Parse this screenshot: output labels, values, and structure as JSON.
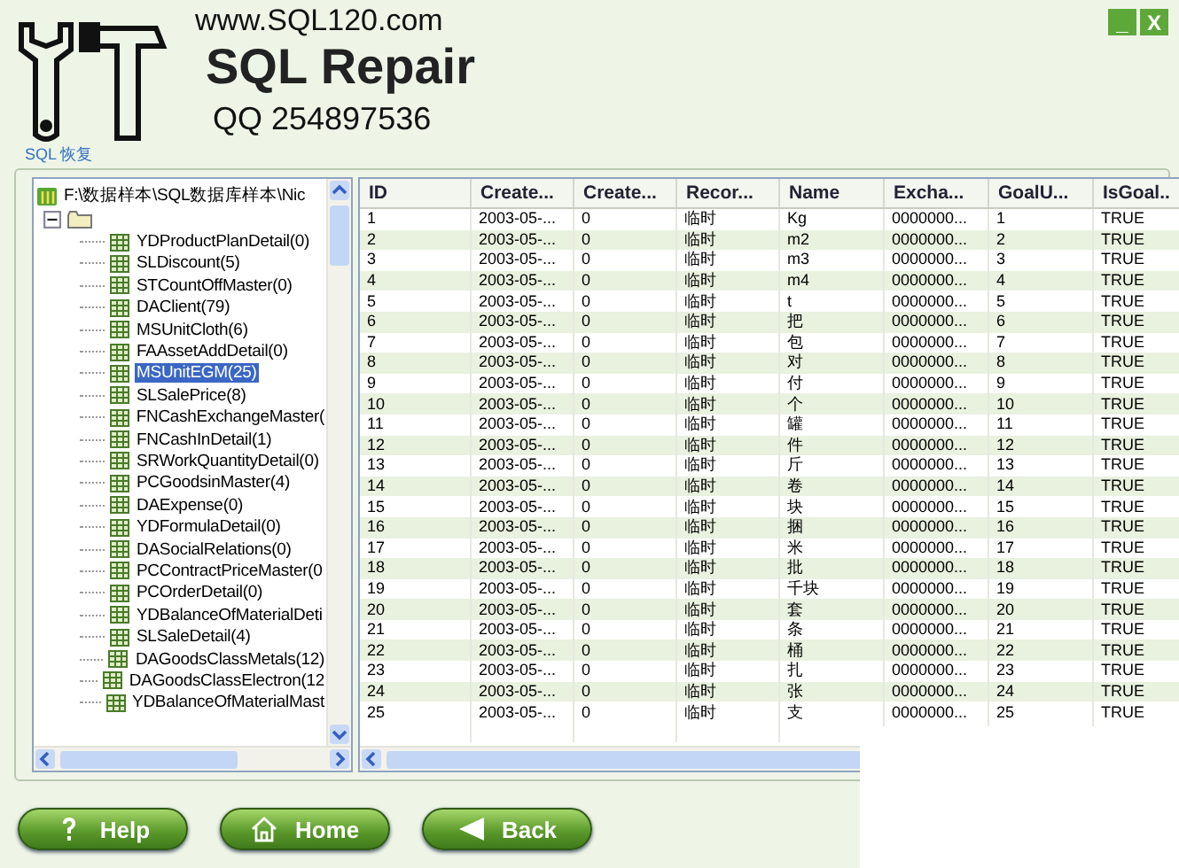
{
  "header": {
    "website": "www.SQL120.com",
    "title": "SQL Repair",
    "contact": "QQ 254897536"
  },
  "window_controls": [
    "_",
    "X"
  ],
  "group_label": "SQL 恢复",
  "tree": {
    "root": "F:\\数据样本\\SQL数据库样本\\Nic",
    "folder": {
      "expanded": true,
      "children": [
        {
          "label": "YDProductPlanDetail(0)",
          "selected": false
        },
        {
          "label": "SLDiscount(5)",
          "selected": false
        },
        {
          "label": "STCountOffMaster(0)",
          "selected": false
        },
        {
          "label": "DAClient(79)",
          "selected": false
        },
        {
          "label": "MSUnitCloth(6)",
          "selected": false
        },
        {
          "label": "FAAssetAddDetail(0)",
          "selected": false
        },
        {
          "label": "MSUnitEGM(25)",
          "selected": true
        },
        {
          "label": "SLSalePrice(8)",
          "selected": false
        },
        {
          "label": "FNCashExchangeMaster(",
          "selected": false
        },
        {
          "label": "FNCashInDetail(1)",
          "selected": false
        },
        {
          "label": "SRWorkQuantityDetail(0)",
          "selected": false
        },
        {
          "label": "PCGoodsinMaster(4)",
          "selected": false
        },
        {
          "label": "DAExpense(0)",
          "selected": false
        },
        {
          "label": "YDFormulaDetail(0)",
          "selected": false
        },
        {
          "label": "DASocialRelations(0)",
          "selected": false
        },
        {
          "label": "PCContractPriceMaster(0",
          "selected": false
        },
        {
          "label": "PCOrderDetail(0)",
          "selected": false
        },
        {
          "label": "YDBalanceOfMaterialDeti",
          "selected": false
        },
        {
          "label": "SLSaleDetail(4)",
          "selected": false
        },
        {
          "label": "DAGoodsClassMetals(12)",
          "selected": false
        },
        {
          "label": "DAGoodsClassElectron(12",
          "selected": false
        },
        {
          "label": "YDBalanceOfMaterialMast",
          "selected": false
        }
      ]
    }
  },
  "table": {
    "columns": [
      "ID",
      "Create...",
      "Create...",
      "Recor...",
      "Name",
      "Excha...",
      "GoalU...",
      "IsGoal.."
    ],
    "rows": [
      [
        "1",
        "2003-05-...",
        "0",
        "临时",
        "Kg",
        "0000000...",
        "1",
        "TRUE"
      ],
      [
        "2",
        "2003-05-...",
        "0",
        "临时",
        "m2",
        "0000000...",
        "2",
        "TRUE"
      ],
      [
        "3",
        "2003-05-...",
        "0",
        "临时",
        "m3",
        "0000000...",
        "3",
        "TRUE"
      ],
      [
        "4",
        "2003-05-...",
        "0",
        "临时",
        "m4",
        "0000000...",
        "4",
        "TRUE"
      ],
      [
        "5",
        "2003-05-...",
        "0",
        "临时",
        "t",
        "0000000...",
        "5",
        "TRUE"
      ],
      [
        "6",
        "2003-05-...",
        "0",
        "临时",
        "把",
        "0000000...",
        "6",
        "TRUE"
      ],
      [
        "7",
        "2003-05-...",
        "0",
        "临时",
        "包",
        "0000000...",
        "7",
        "TRUE"
      ],
      [
        "8",
        "2003-05-...",
        "0",
        "临时",
        "对",
        "0000000...",
        "8",
        "TRUE"
      ],
      [
        "9",
        "2003-05-...",
        "0",
        "临时",
        "付",
        "0000000...",
        "9",
        "TRUE"
      ],
      [
        "10",
        "2003-05-...",
        "0",
        "临时",
        "个",
        "0000000...",
        "10",
        "TRUE"
      ],
      [
        "11",
        "2003-05-...",
        "0",
        "临时",
        "罐",
        "0000000...",
        "11",
        "TRUE"
      ],
      [
        "12",
        "2003-05-...",
        "0",
        "临时",
        "件",
        "0000000...",
        "12",
        "TRUE"
      ],
      [
        "13",
        "2003-05-...",
        "0",
        "临时",
        "斤",
        "0000000...",
        "13",
        "TRUE"
      ],
      [
        "14",
        "2003-05-...",
        "0",
        "临时",
        "卷",
        "0000000...",
        "14",
        "TRUE"
      ],
      [
        "15",
        "2003-05-...",
        "0",
        "临时",
        "块",
        "0000000...",
        "15",
        "TRUE"
      ],
      [
        "16",
        "2003-05-...",
        "0",
        "临时",
        "捆",
        "0000000...",
        "16",
        "TRUE"
      ],
      [
        "17",
        "2003-05-...",
        "0",
        "临时",
        "米",
        "0000000...",
        "17",
        "TRUE"
      ],
      [
        "18",
        "2003-05-...",
        "0",
        "临时",
        "批",
        "0000000...",
        "18",
        "TRUE"
      ],
      [
        "19",
        "2003-05-...",
        "0",
        "临时",
        "千块",
        "0000000...",
        "19",
        "TRUE"
      ],
      [
        "20",
        "2003-05-...",
        "0",
        "临时",
        "套",
        "0000000...",
        "20",
        "TRUE"
      ],
      [
        "21",
        "2003-05-...",
        "0",
        "临时",
        "条",
        "0000000...",
        "21",
        "TRUE"
      ],
      [
        "22",
        "2003-05-...",
        "0",
        "临时",
        "桶",
        "0000000...",
        "22",
        "TRUE"
      ],
      [
        "23",
        "2003-05-...",
        "0",
        "临时",
        "扎",
        "0000000...",
        "23",
        "TRUE"
      ],
      [
        "24",
        "2003-05-...",
        "0",
        "临时",
        "张",
        "0000000...",
        "24",
        "TRUE"
      ],
      [
        "25",
        "2003-05-...",
        "0",
        "临时",
        "支",
        "0000000...",
        "25",
        "TRUE"
      ]
    ]
  },
  "buttons": [
    {
      "label": "Help",
      "kind": "help"
    },
    {
      "label": "Home",
      "kind": "home"
    },
    {
      "label": "Back",
      "kind": "back"
    }
  ]
}
